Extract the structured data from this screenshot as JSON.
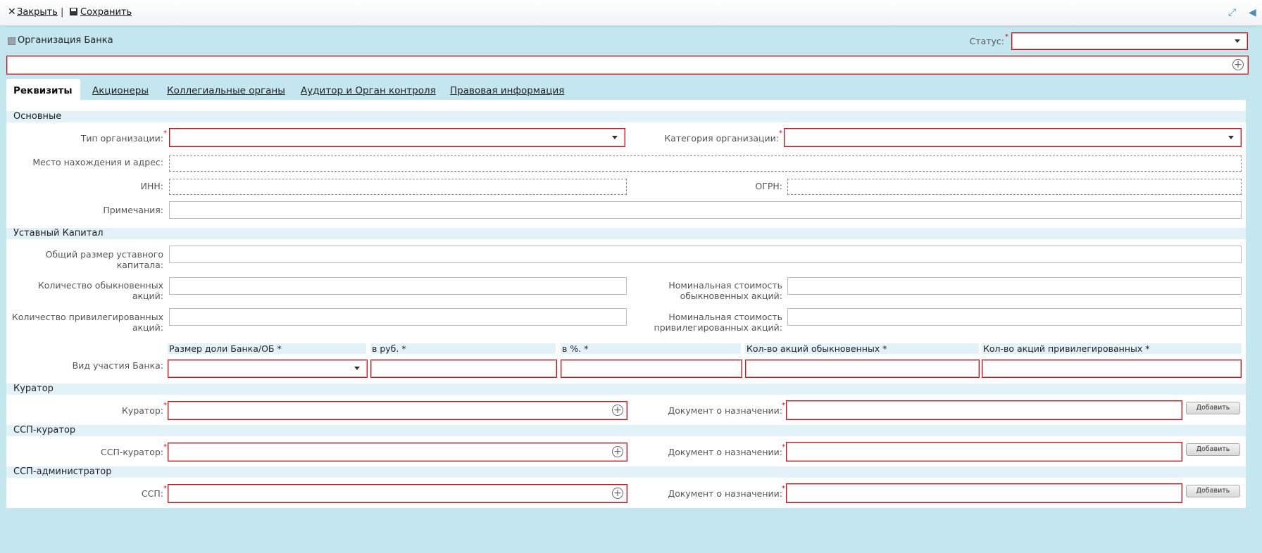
{
  "toolbar": {
    "close_label": "Закрыть",
    "separator": "|",
    "save_label": "Сохранить"
  },
  "header": {
    "title": "Организация Банка",
    "status_label": "Статус:",
    "status_value": "",
    "name_value": ""
  },
  "tabs": [
    {
      "label": "Реквизиты",
      "active": true
    },
    {
      "label": "Акционеры",
      "active": false
    },
    {
      "label": "Коллегиальные органы",
      "active": false
    },
    {
      "label": "Аудитор и Орган контроля",
      "active": false
    },
    {
      "label": "Правовая информация",
      "active": false
    }
  ],
  "sections": {
    "main": "Основные",
    "capital": "Уставный Капитал",
    "curator": "Куратор",
    "ssp_curator": "ССП-куратор",
    "ssp_admin": "ССП-администратор"
  },
  "fields": {
    "org_type": {
      "label": "Тип организации:",
      "value": ""
    },
    "org_category": {
      "label": "Категория организации:",
      "value": ""
    },
    "address": {
      "label": "Место нахождения и адрес:",
      "value": ""
    },
    "inn": {
      "label": "ИНН:",
      "value": ""
    },
    "ogrn": {
      "label": "ОГРН:",
      "value": ""
    },
    "notes": {
      "label": "Примечания:",
      "value": ""
    },
    "capital_total": {
      "label": "Общий размер уставного капитала:",
      "value": ""
    },
    "common_shares_count": {
      "label": "Количество обыкновенных акций:",
      "value": ""
    },
    "common_shares_nominal": {
      "label": "Номинальная стоимость обыкновенных акций:",
      "value": ""
    },
    "pref_shares_count": {
      "label": "Количество привилегированных акций:",
      "value": ""
    },
    "pref_shares_nominal": {
      "label": "Номинальная стоимость привилегированных акций:",
      "value": ""
    },
    "participation": {
      "label": "Вид участия Банка:"
    },
    "curator": {
      "label": "Куратор:",
      "value": ""
    },
    "curator_doc": {
      "label": "Документ о назначении:",
      "value": ""
    },
    "ssp_curator": {
      "label": "ССП-куратор:",
      "value": ""
    },
    "ssp_curator_doc": {
      "label": "Документ о назначении:",
      "value": ""
    },
    "ssp": {
      "label": "ССП:",
      "value": ""
    },
    "ssp_doc": {
      "label": "Документ о назначении:",
      "value": ""
    }
  },
  "participation_columns": [
    "Размер доли Банка/ОБ *",
    "в руб. *",
    "в %. *",
    "Кол-во акций обыкновенных *",
    "Кол-во акций привилегированных *"
  ],
  "buttons": {
    "add": "Добавить"
  },
  "required_mark": "*",
  "colors": {
    "background": "#c3e6ef",
    "required_border": "#c0141e",
    "section_bg": "#e3f1f8"
  }
}
